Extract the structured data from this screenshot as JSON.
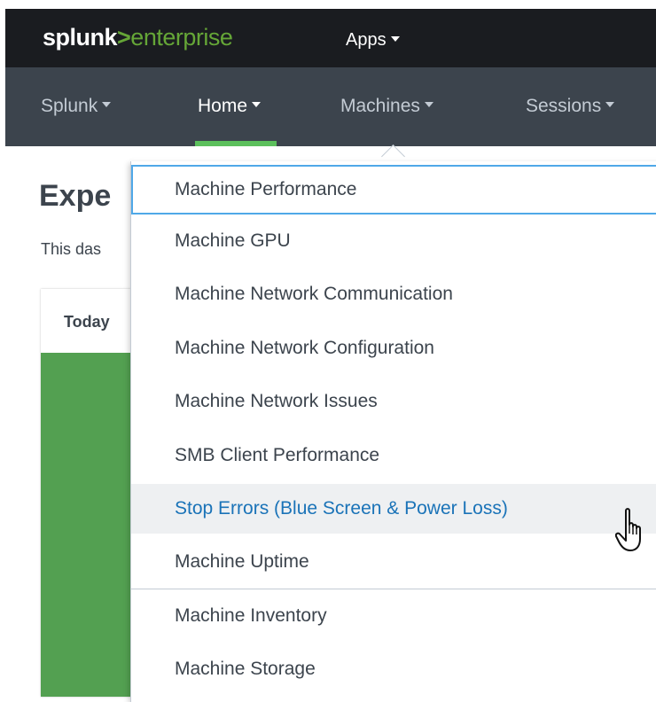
{
  "header": {
    "brand_splunk": "splunk",
    "brand_gt": ">",
    "brand_enterprise": "enterprise",
    "apps_label": "Apps"
  },
  "nav": {
    "items": [
      {
        "label": "Splunk",
        "active": false
      },
      {
        "label": "Home",
        "active": true
      },
      {
        "label": "Machines",
        "active": false
      },
      {
        "label": "Sessions",
        "active": false
      }
    ]
  },
  "page": {
    "title": "Expe",
    "description": "This das",
    "panel_title": "Today"
  },
  "dropdown": {
    "items": [
      {
        "label": "Machine Performance",
        "state": "focused"
      },
      {
        "label": "Machine GPU",
        "state": "normal"
      },
      {
        "label": "Machine Network Communication",
        "state": "normal"
      },
      {
        "label": "Machine Network Configuration",
        "state": "normal"
      },
      {
        "label": "Machine Network Issues",
        "state": "normal"
      },
      {
        "label": "SMB Client Performance",
        "state": "normal"
      },
      {
        "label": "Stop Errors (Blue Screen & Power Loss)",
        "state": "hovered"
      },
      {
        "label": "Machine Uptime",
        "state": "normal"
      },
      {
        "label": "Machine Inventory",
        "state": "normal"
      },
      {
        "label": "Machine Storage",
        "state": "normal"
      }
    ]
  },
  "colors": {
    "appbar_bg": "#1a1c20",
    "navbar_bg": "#3c444d",
    "brand_green": "#65a637",
    "active_underline": "#5cc05c",
    "panel_green": "#53a051",
    "hover_text": "#1a73b8",
    "focus_border": "#4fa8e8"
  },
  "icons": {
    "cursor": "hand-pointer-icon"
  }
}
